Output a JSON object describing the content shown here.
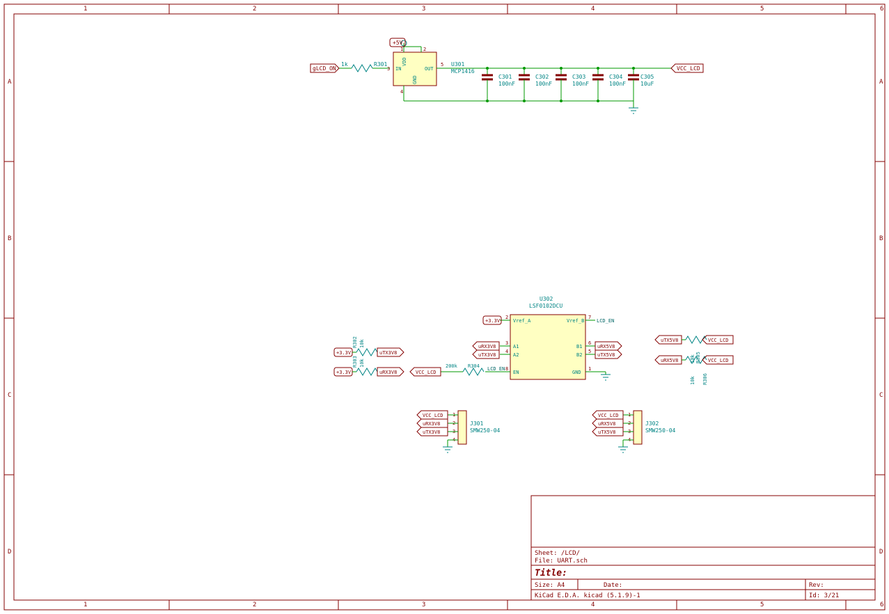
{
  "frame": {
    "cols": [
      "1",
      "2",
      "3",
      "4",
      "5"
    ],
    "rows": [
      "A",
      "B",
      "C",
      "D"
    ],
    "corners": [
      "6",
      "6",
      "6",
      "6"
    ]
  },
  "title_block": {
    "sheet": "Sheet: /LCD/",
    "file": "File: UART.sch",
    "title": "Title:",
    "size": "Size: A4",
    "date": "Date:",
    "rev": "Rev:",
    "gen": "KiCad E.D.A.  kicad (5.1.9)-1",
    "id": "Id: 3/21"
  },
  "top": {
    "in_label": "gLCD_ON",
    "r301": "R301",
    "r301_val": "1k",
    "pwr": "+5V",
    "u301": {
      "ref": "U301",
      "part": "MCP1416",
      "pin_in": "IN",
      "pin_out": "OUT",
      "pin_vdd": "VDD",
      "pin_gnd": "GND",
      "pn_in": "3",
      "pn_out": "5",
      "pn_vdd": "1",
      "pn_vdd2": "2",
      "pn_gnd": "4"
    },
    "out_label": "VCC_LCD",
    "caps": [
      {
        "ref": "C301",
        "val": "100nF"
      },
      {
        "ref": "C302",
        "val": "100nF"
      },
      {
        "ref": "C303",
        "val": "100nF"
      },
      {
        "ref": "C304",
        "val": "100nF"
      },
      {
        "ref": "C305",
        "val": "10uF"
      }
    ]
  },
  "mid": {
    "u302": {
      "ref": "U302",
      "part": "LSF0102DCU",
      "pins": {
        "VrefA": "Vref_A",
        "VrefB": "Vref_B",
        "A1": "A1",
        "A2": "A2",
        "B1": "B1",
        "B2": "B2",
        "EN": "EN",
        "GND": "GND"
      },
      "pn": {
        "VrefA": "2",
        "VrefB": "7",
        "A1": "3",
        "A2": "4",
        "B1": "6",
        "B2": "5",
        "EN": "8",
        "GND": "1"
      }
    },
    "p33": "+3.3V",
    "nets": {
      "R302": "R302",
      "R303": "R303",
      "R304": "R304",
      "R305": "R305",
      "R306": "R306",
      "r_val_10k": "10k",
      "r_val_200k": "200k",
      "uTX3V8": "uTX3V8",
      "uRX3V8": "uRX3V8",
      "uRX5V8": "uRX5V8",
      "uTX5V8": "uTX5V8",
      "VCC_LCD": "VCC_LCD",
      "LCD_EN": "LCD_EN"
    }
  },
  "conns": {
    "J301": {
      "ref": "J301",
      "part": "SMW250-04",
      "p1": "VCC_LCD",
      "p2": "uRX3V8",
      "p3": "uTX3V8",
      "pins": [
        "1",
        "2",
        "3",
        "4"
      ]
    },
    "J302": {
      "ref": "J302",
      "part": "SMW250-04",
      "p1": "VCC_LCD",
      "p2": "uRX5V8",
      "p3": "uTX5V8",
      "pins": [
        "1",
        "2",
        "3",
        "4"
      ]
    }
  }
}
